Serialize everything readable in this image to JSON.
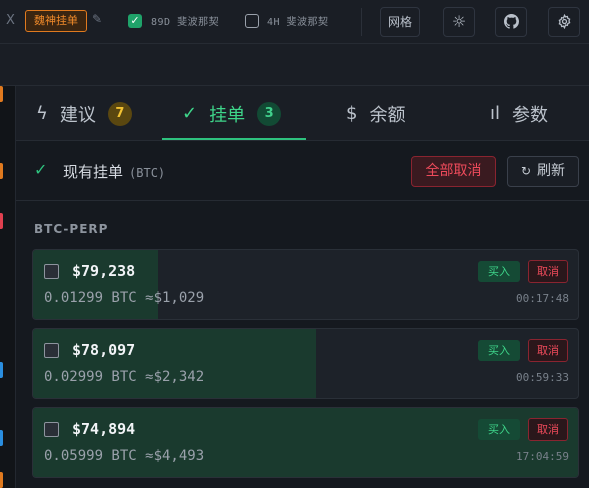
{
  "toolbar": {
    "x_glyph": "X",
    "tag_label": "魏神挂单",
    "pencil_glyph": "✎",
    "checkbox1_label": "89D 斐波那契",
    "checkbox1_checked": true,
    "checkbox2_label": "4H 斐波那契",
    "checkbox2_checked": false,
    "grid_button": "网格",
    "theme_icon": "☼",
    "github_icon": "github-icon",
    "settings_icon": "gear-icon"
  },
  "tabs": [
    {
      "icon": "ϟ",
      "label": "建议",
      "badge": "7"
    },
    {
      "icon": "✓",
      "label": "挂单",
      "badge": "3",
      "active": true
    },
    {
      "icon": "$",
      "label": "余额"
    },
    {
      "icon": "ıl",
      "label": "参数"
    }
  ],
  "list_header": {
    "check": "✓",
    "title": "现有挂单",
    "unit": "(BTC)",
    "cancel_all": "全部取消",
    "refresh_icon": "↻",
    "refresh": "刷新"
  },
  "group_label": "BTC-PERP",
  "orders": [
    {
      "price": "$79,238",
      "size": "0.01299 BTC ≈$1,029",
      "buy": "买入",
      "cancel": "取消",
      "time": "00:17:48",
      "fill_fraction": 0.23
    },
    {
      "price": "$78,097",
      "size": "0.02999 BTC ≈$2,342",
      "buy": "买入",
      "cancel": "取消",
      "time": "00:59:33",
      "fill_fraction": 0.52
    },
    {
      "price": "$74,894",
      "size": "0.05999 BTC ≈$4,493",
      "buy": "买入",
      "cancel": "取消",
      "time": "17:04:59",
      "fill_fraction": 1.0
    }
  ],
  "colors": {
    "accent_green": "#2ec27e",
    "danger_red": "#ef4b5b",
    "tag_orange": "#f08a2a",
    "badge_amber": "#f2c233"
  }
}
